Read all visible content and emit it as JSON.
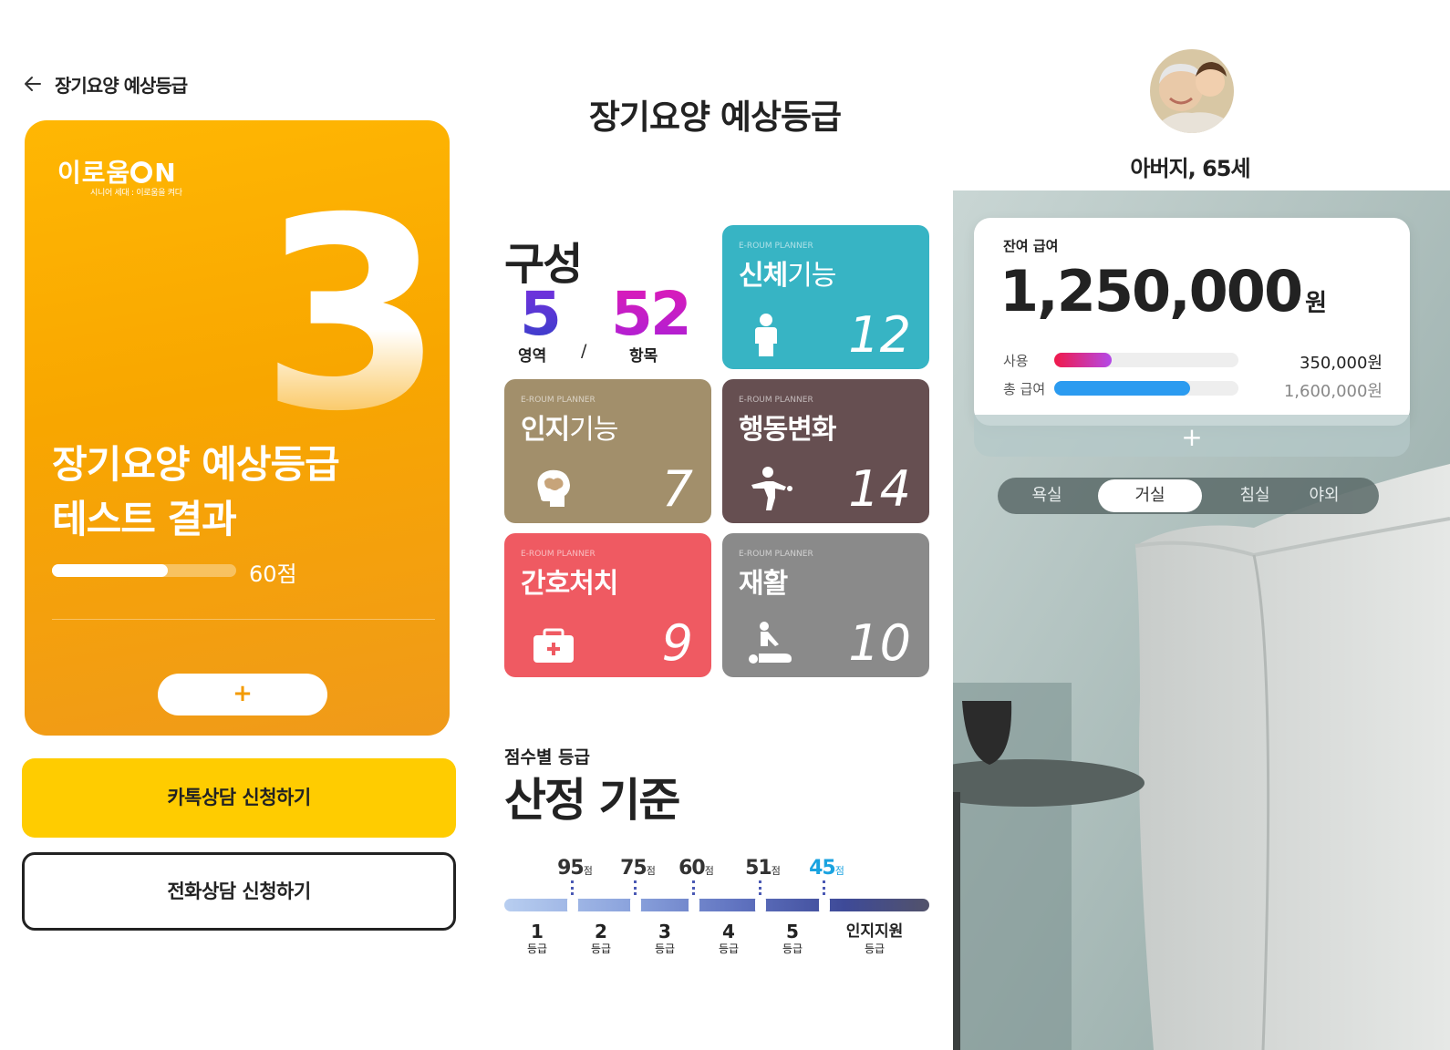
{
  "header": {
    "title": "장기요양 예상등급"
  },
  "result_card": {
    "logo": "이로움ON",
    "logo_tagline": "시니어 세대 : 이로움을 켜다",
    "grade": "3",
    "title_line1": "장기요양 예상등급",
    "title_line2": "테스트 결과",
    "score_label": "60점",
    "score_fraction": 0.63,
    "plus_label": "+"
  },
  "buttons": {
    "kakao_consult": "카톡상담 신청하기",
    "phone_consult": "전화상담 신청하기"
  },
  "middle": {
    "title": "장기요양 예상등급",
    "composition": {
      "label": "구성",
      "areas_count": "5",
      "areas_label": "영역",
      "separator": "/",
      "items_count": "52",
      "items_label": "항목"
    },
    "tiles": [
      {
        "brand": "E-ROUM PLANNER",
        "name_bold": "신체",
        "name_light": "기능",
        "count": "12",
        "color": "#37b4c4",
        "icon": "person-standing-icon"
      },
      {
        "brand": "E-ROUM PLANNER",
        "name_bold": "인지",
        "name_light": "기능",
        "count": "7",
        "color": "#a28f6b",
        "icon": "brain-head-icon"
      },
      {
        "brand": "E-ROUM PLANNER",
        "name_bold": "행동변화",
        "name_light": "",
        "count": "14",
        "color": "#664f51",
        "icon": "person-gesture-icon"
      },
      {
        "brand": "E-ROUM PLANNER",
        "name_bold": "간호처치",
        "name_light": "",
        "count": "9",
        "color": "#ef5a62",
        "icon": "first-aid-kit-icon"
      },
      {
        "brand": "E-ROUM PLANNER",
        "name_bold": "재활",
        "name_light": "",
        "count": "10",
        "color": "#8a8a8a",
        "icon": "massage-rehab-icon"
      }
    ],
    "criteria": {
      "subtitle": "점수별 등급",
      "title": "산정 기준",
      "unit": "점",
      "grade_unit": "등급",
      "thresholds": [
        "95",
        "75",
        "60",
        "51",
        "45"
      ],
      "highlight_color": "#1aa3e0",
      "grades": [
        "1",
        "2",
        "3",
        "4",
        "5",
        "인지지원"
      ]
    }
  },
  "right": {
    "profile_name": "아버지, 65세",
    "balance_label": "잔여 급여",
    "balance_amount": "1,250,000",
    "balance_unit": "원",
    "used_label": "사용",
    "used_value": "350,000원",
    "used_fraction": 0.31,
    "total_label": "총 급여",
    "total_value": "1,600,000원",
    "total_fraction": 0.74,
    "expand_label": "+",
    "rooms": [
      "욕실",
      "거실",
      "침실",
      "야외"
    ],
    "active_room": "거실"
  }
}
